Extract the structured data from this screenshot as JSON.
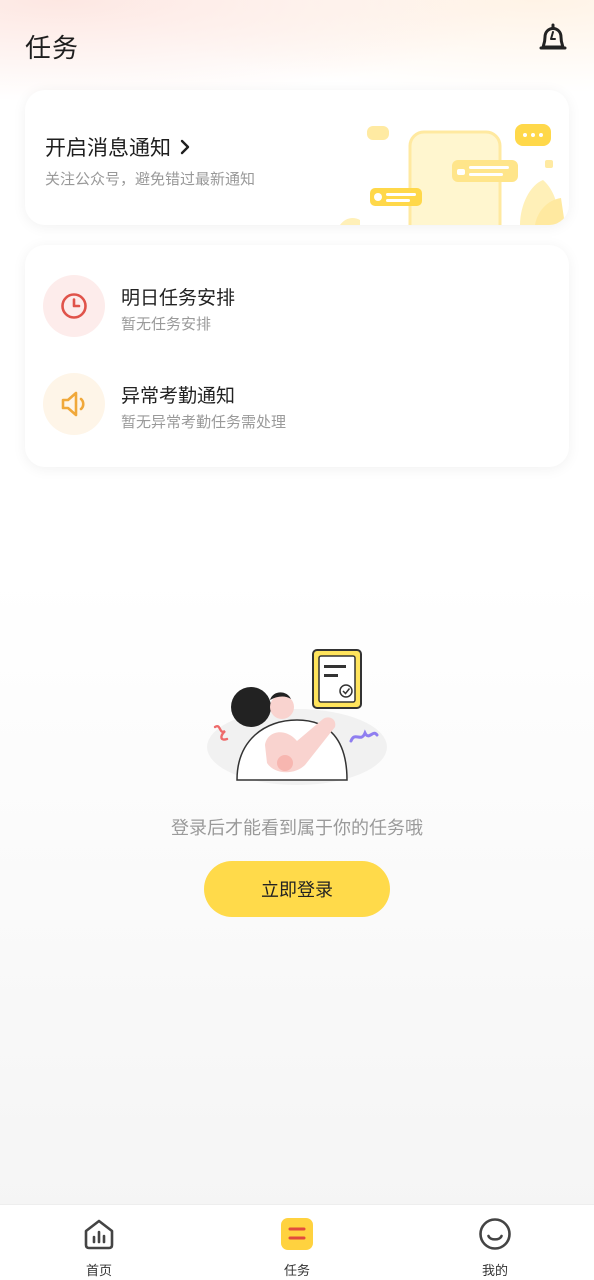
{
  "header": {
    "title": "任务"
  },
  "notify": {
    "title": "开启消息通知",
    "subtitle": "关注公众号，避免错过最新通知"
  },
  "tasks": [
    {
      "title": "明日任务安排",
      "subtitle": "暂无任务安排",
      "icon": "clock-icon",
      "color": "#e0534a",
      "bg": "#fdeceb"
    },
    {
      "title": "异常考勤通知",
      "subtitle": "暂无异常考勤任务需处理",
      "icon": "speaker-icon",
      "color": "#f0a83a",
      "bg": "#fef5e8"
    }
  ],
  "empty": {
    "message": "登录后才能看到属于你的任务哦",
    "login_label": "立即登录"
  },
  "tabbar": {
    "items": [
      {
        "label": "首页",
        "icon": "home-chart-icon",
        "active": false
      },
      {
        "label": "任务",
        "icon": "task-list-icon",
        "active": true
      },
      {
        "label": "我的",
        "icon": "smile-icon",
        "active": false
      }
    ]
  },
  "colors": {
    "accent": "#ffda4a",
    "danger": "#e0534a",
    "warn": "#f0a83a"
  }
}
